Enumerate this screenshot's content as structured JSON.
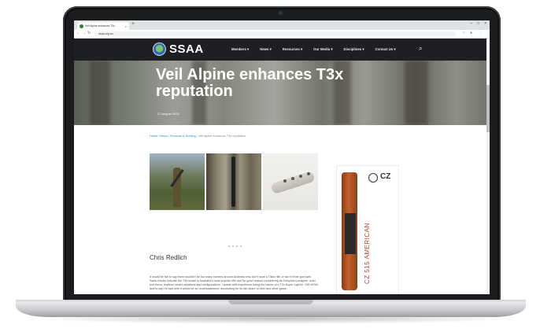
{
  "browser": {
    "tab_title": "Veil Alpine enhances T3x...",
    "tab_close": "×",
    "new_tab": "+",
    "window_controls": [
      "–",
      "□",
      "×"
    ],
    "url": "ssaa.org.au"
  },
  "site": {
    "logo": "SSAA",
    "menu": [
      "Members ▾",
      "News ▾",
      "Resources ▾",
      "Our Media ▾",
      "Disciplines ▾",
      "Contact Us ▾"
    ]
  },
  "hero": {
    "title": "Veil Alpine enhances T3x reputation",
    "date": "27 August 2021"
  },
  "article": {
    "breadcrumb": [
      "Home",
      "News",
      "Firearms & Hunting",
      "Veil Alpine enhances T3x reputation"
    ],
    "author": "Chris Redlich",
    "paragraph": "It would be fair to say there wouldn't be too many hunters around Australia who don't have a Tikka rifle or two in their gun safe. Sales results indicate the T3x model is Australia's most popular rifle and for good reason considering its European pedigree, solid bolt throw, endless model variations and configurations. I speak with experience being the owner of a T3x Super Light in .300 WSM and to say I'm rapt with it would be an understatement, accounting for its fair share of deer and other game."
  },
  "ad": {
    "brand": "CZ",
    "model": "CZ 515 AMERICAN"
  },
  "colors": {
    "nav_bg": "#1d1f22",
    "link": "#2a8bc7",
    "ad_accent": "#b0472c"
  }
}
